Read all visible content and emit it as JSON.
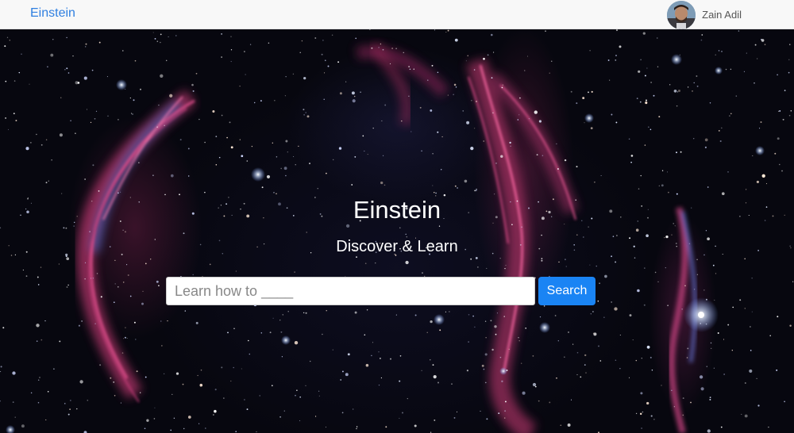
{
  "navbar": {
    "brand": "Einstein",
    "user_name": "Zain Adil"
  },
  "hero": {
    "title": "Einstein",
    "subtitle": "Discover & Learn"
  },
  "search": {
    "placeholder": "Learn how to ____",
    "value": "",
    "button_label": "Search"
  },
  "colors": {
    "brand": "#2f7fe0",
    "button": "#1a84f4",
    "navbar_bg": "#f8f8f8"
  },
  "icons": {
    "avatar": "user-avatar-photo"
  }
}
